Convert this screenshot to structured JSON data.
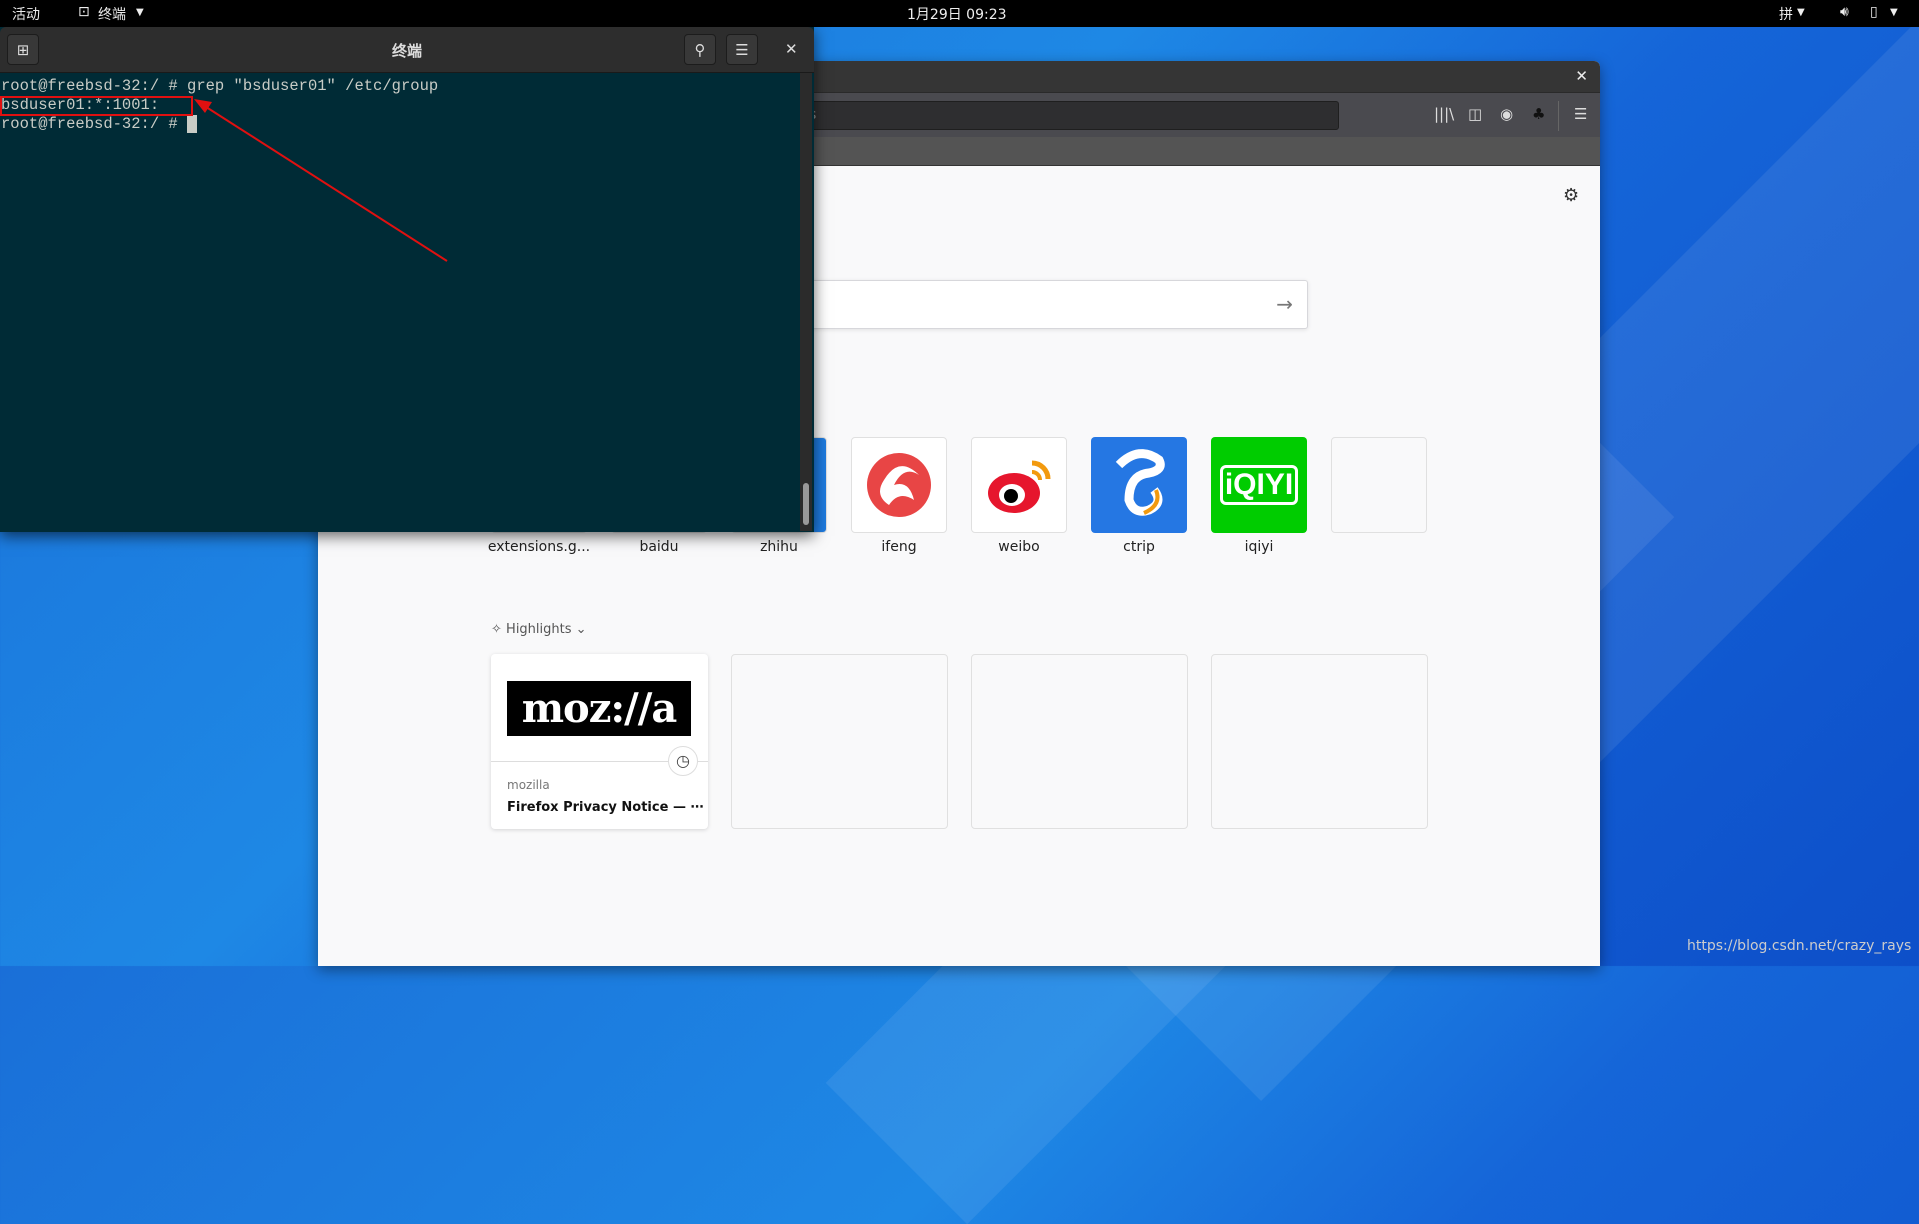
{
  "topbar": {
    "activities": "活动",
    "app": "终端",
    "clock": "1月29日 09:23",
    "input_method": "拼"
  },
  "terminal": {
    "title": "终端",
    "lines": [
      "root@freebsd-32:/ # grep \"bsduser01\" /etc/group",
      "bsduser01:*:1001:",
      "root@freebsd-32:/ # "
    ]
  },
  "firefox": {
    "url_partial": "s",
    "topsites": [
      {
        "label": "extensions.g..."
      },
      {
        "label": "baidu"
      },
      {
        "label": "zhihu"
      },
      {
        "label": "ifeng",
        "color": "#e84545"
      },
      {
        "label": "weibo",
        "color": "#e6162d"
      },
      {
        "label": "ctrip",
        "color": "#2577e3"
      },
      {
        "label": "iqiyi",
        "color": "#00cc00"
      },
      {
        "label": ""
      }
    ],
    "highlights_label": "Highlights",
    "card": {
      "logo": "moz://a",
      "site": "mozilla",
      "title": "Firefox Privacy Notice — ⋯"
    }
  },
  "watermark": "https://blog.csdn.net/crazy_rays",
  "colors": {
    "terminal_bg": "#002b36",
    "annotation": "#e01010"
  }
}
